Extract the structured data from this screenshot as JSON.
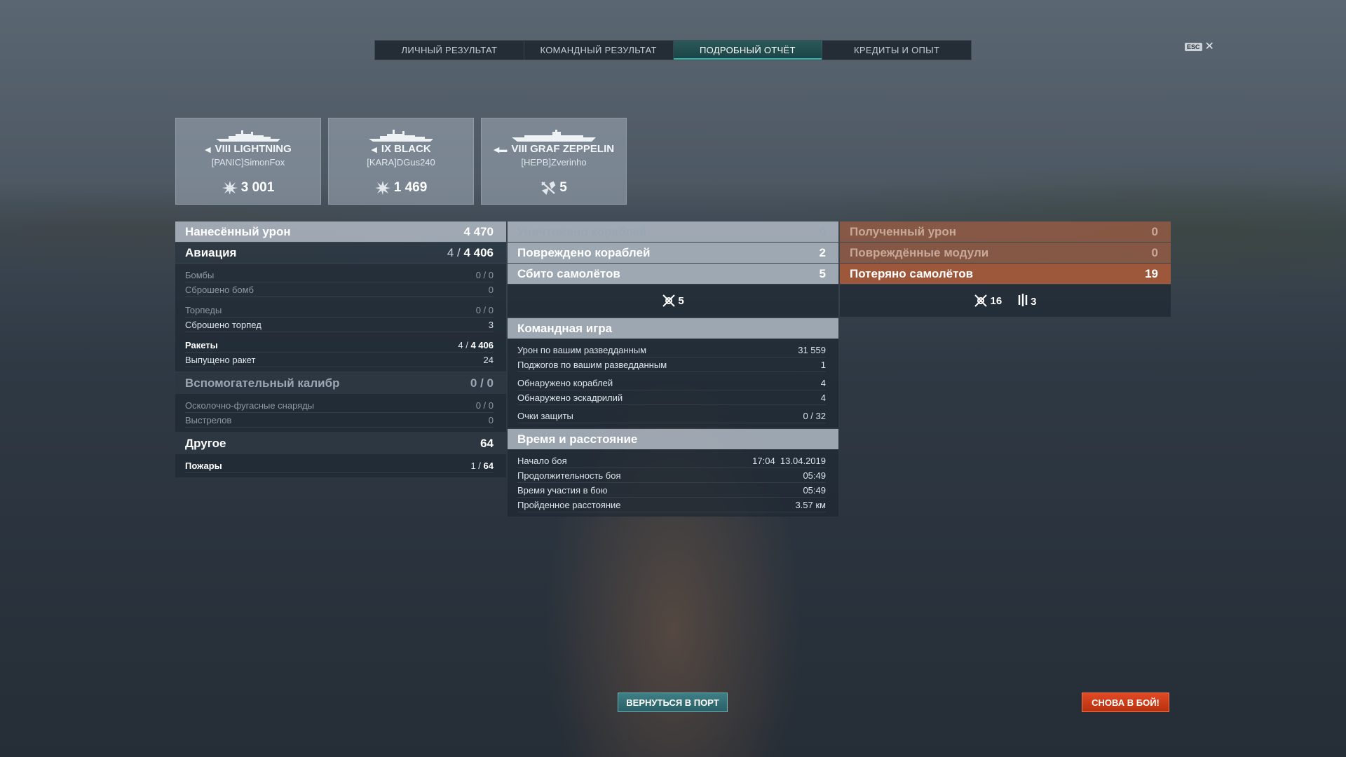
{
  "tabs": [
    {
      "label": "ЛИЧНЫЙ РЕЗУЛЬТАТ"
    },
    {
      "label": "КОМАНДНЫЙ РЕЗУЛЬТАТ"
    },
    {
      "label": "ПОДРОБНЫЙ ОТЧЁТ",
      "active": true
    },
    {
      "label": "КРЕДИТЫ И ОПЫТ"
    }
  ],
  "esc": {
    "key": "ESC",
    "close": "✕"
  },
  "cards": [
    {
      "tier_name": "VIII LIGHTNING",
      "player": "[PANIC]SimonFox",
      "stat": "3 001",
      "stat_icon": "damage-icon",
      "class_icon": "destroyer-icon"
    },
    {
      "tier_name": "IX BLACK",
      "player": "[KARA]DGus240",
      "stat": "1 469",
      "stat_icon": "damage-icon",
      "class_icon": "destroyer-icon"
    },
    {
      "tier_name": "VIII GRAF ZEPPELIN",
      "player": "[HEPB]Zverinho",
      "stat": "5",
      "stat_icon": "plane-shot-icon",
      "class_icon": "carrier-icon"
    }
  ],
  "left": {
    "damage": {
      "label": "Нанесённый урон",
      "value": "4 470"
    },
    "aviation": {
      "label": "Авиация",
      "value_a": "4 / ",
      "value_b": "4 406"
    },
    "bombs": {
      "label": "Бомбы",
      "value": "0 / 0"
    },
    "bombs_dropped": {
      "label": "Сброшено бомб",
      "value": "0"
    },
    "torpedoes": {
      "label": "Торпеды",
      "value": "0 / 0"
    },
    "torpedoes_dropped": {
      "label": "Сброшено торпед",
      "value": "3"
    },
    "rockets": {
      "label": "Ракеты",
      "value_a": "4 / ",
      "value_b": "4 406"
    },
    "rockets_fired": {
      "label": "Выпущено ракет",
      "value": "24"
    },
    "secondary": {
      "label": "Вспомогательный калибр",
      "value": "0 / 0"
    },
    "he_shells": {
      "label": "Осколочно-фугасные снаряды",
      "value": "0 / 0"
    },
    "shots": {
      "label": "Выстрелов",
      "value": "0"
    },
    "other": {
      "label": "Другое",
      "value": "64"
    },
    "fires": {
      "label": "Пожары",
      "value_a": "1 / ",
      "value_b": "64"
    }
  },
  "middle": {
    "destroyed": {
      "label": "Уничтожено кораблей",
      "value": "0"
    },
    "damaged": {
      "label": "Повреждено кораблей",
      "value": "2"
    },
    "planes_shot": {
      "label": "Сбито самолётов",
      "value": "5"
    },
    "planes_icon_count": "5",
    "team_title": "Командная игра",
    "scouted_damage": {
      "label": "Урон по вашим разведданным",
      "value": "31 559"
    },
    "scouted_fires": {
      "label": "Поджогов по вашим разведданным",
      "value": "1"
    },
    "ships_spotted": {
      "label": "Обнаружено кораблей",
      "value": "4"
    },
    "squadrons_spotted": {
      "label": "Обнаружено эскадрилий",
      "value": "4"
    },
    "defense_points": {
      "label": "Очки защиты",
      "value": "0 / 32"
    },
    "time_title": "Время и расстояние",
    "battle_start": {
      "label": "Начало боя",
      "value": "17:04  13.04.2019"
    },
    "battle_duration": {
      "label": "Продолжительность боя",
      "value": "05:49"
    },
    "time_in_battle": {
      "label": "Время участия в бою",
      "value": "05:49"
    },
    "distance": {
      "label": "Пройденное расстояние",
      "value": "3.57 км"
    }
  },
  "right": {
    "received": {
      "label": "Полученный урон",
      "value": "0"
    },
    "modules": {
      "label": "Повреждённые модули",
      "value": "0"
    },
    "planes_lost": {
      "label": "Потеряно самолётов",
      "value": "19"
    },
    "lost_shot_count": "16",
    "lost_other_count": "3"
  },
  "buttons": {
    "port": "ВЕРНУТЬСЯ В ПОРТ",
    "battle": "СНОВА В БОЙ!"
  },
  "colors": {
    "accent": "#2fb7a7",
    "battle_button": "#d0401a",
    "received_panel": "#a85a3a"
  }
}
